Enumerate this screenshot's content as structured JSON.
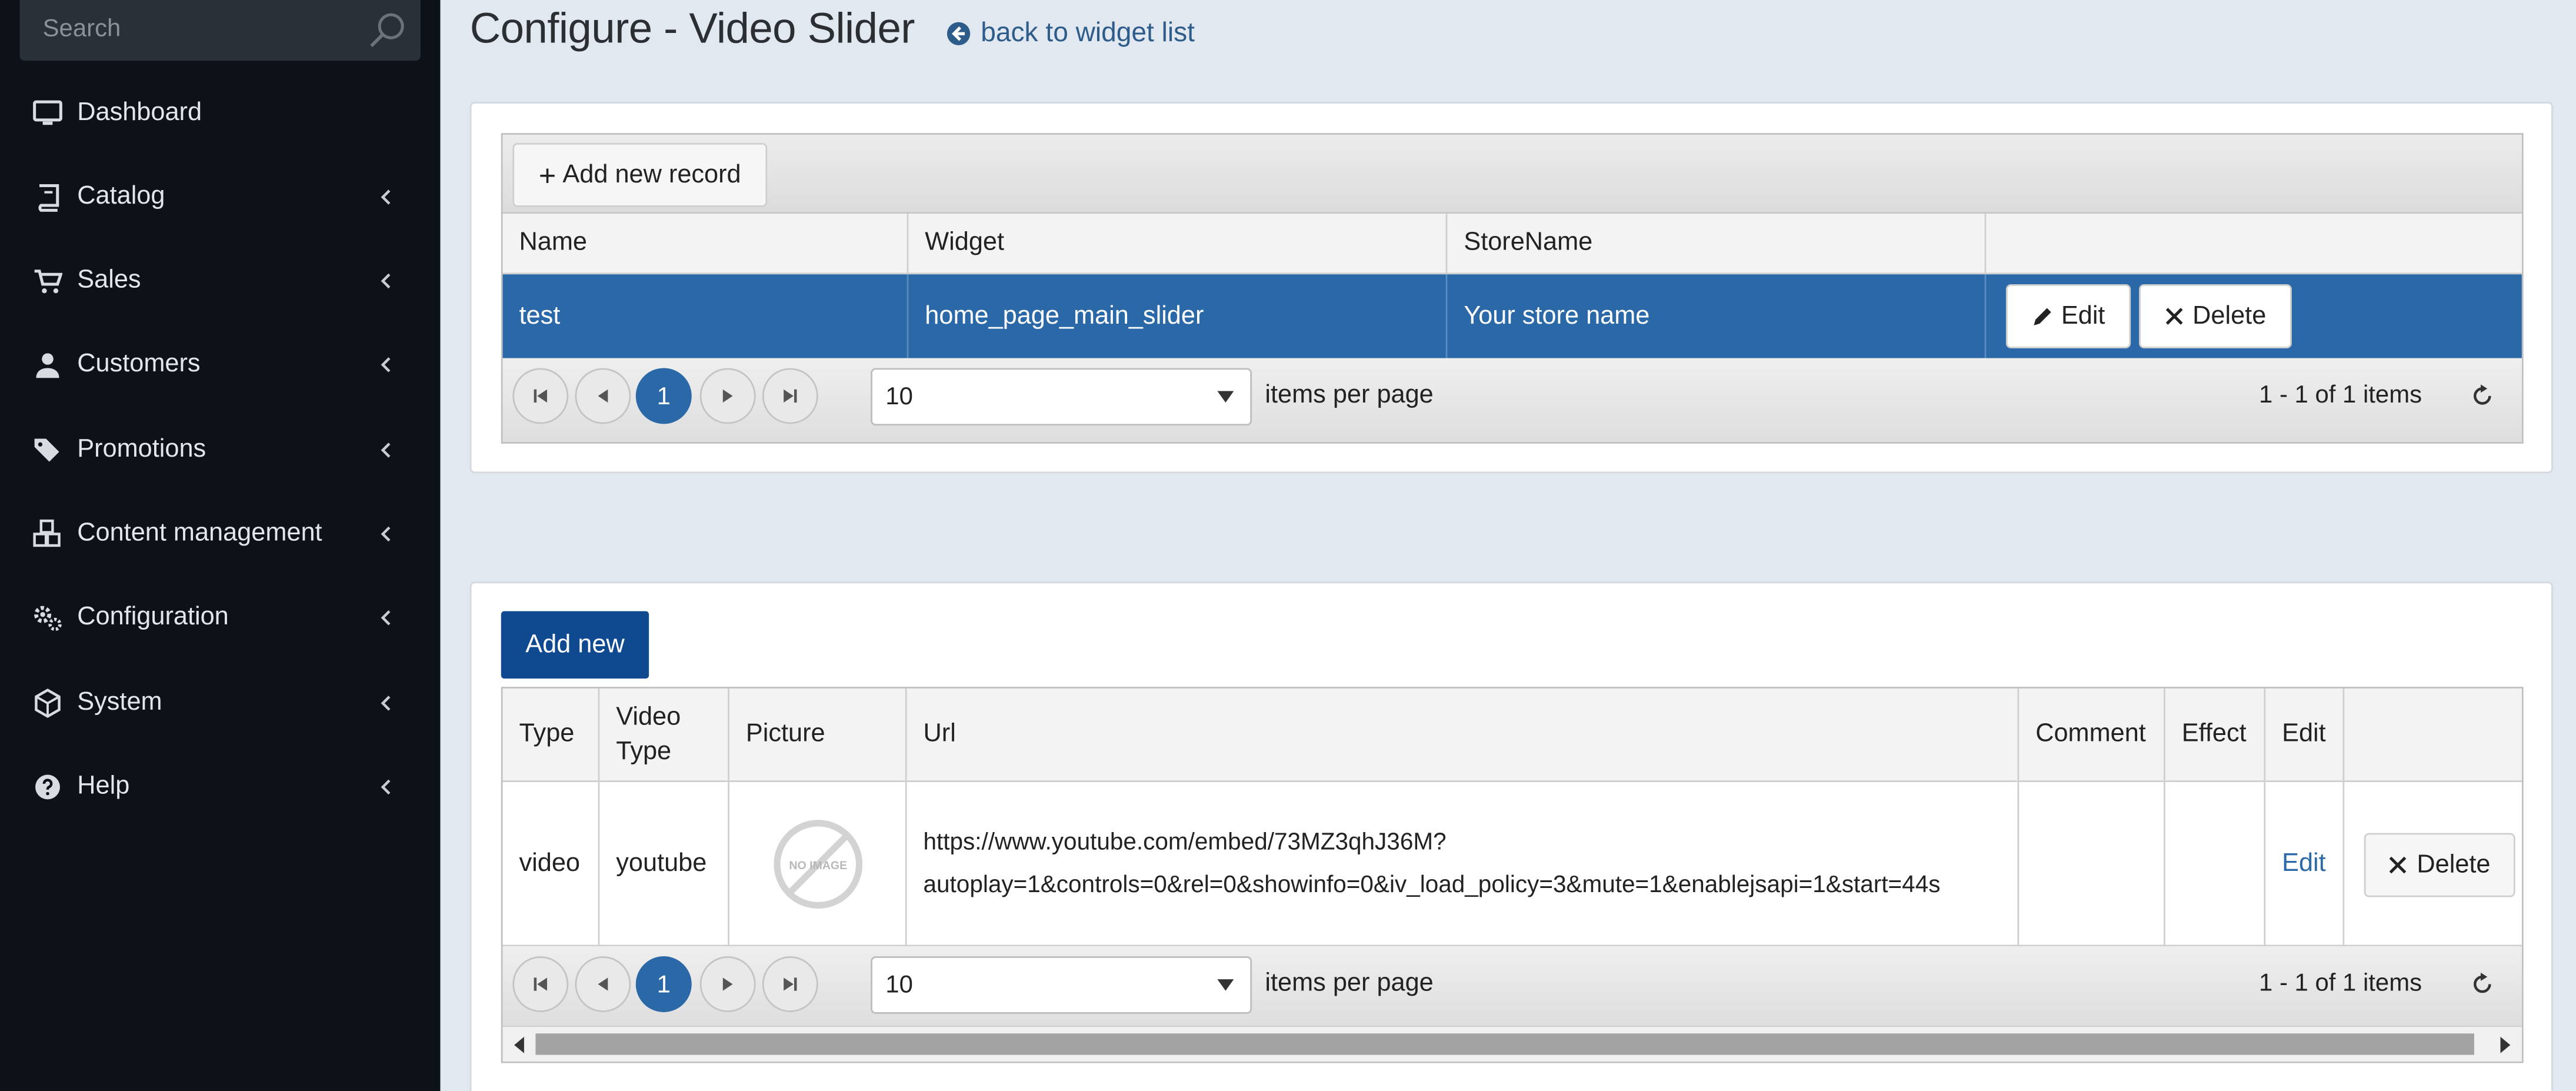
{
  "sidebar": {
    "search": {
      "placeholder": "Search"
    },
    "items": [
      {
        "label": "Dashboard",
        "icon": "desktop-icon",
        "has_submenu": false
      },
      {
        "label": "Catalog",
        "icon": "book-icon",
        "has_submenu": true
      },
      {
        "label": "Sales",
        "icon": "cart-icon",
        "has_submenu": true
      },
      {
        "label": "Customers",
        "icon": "user-icon",
        "has_submenu": true
      },
      {
        "label": "Promotions",
        "icon": "tags-icon",
        "has_submenu": true
      },
      {
        "label": "Content management",
        "icon": "cubes-icon",
        "has_submenu": true
      },
      {
        "label": "Configuration",
        "icon": "gears-icon",
        "has_submenu": true
      },
      {
        "label": "System",
        "icon": "cube-icon",
        "has_submenu": true
      },
      {
        "label": "Help",
        "icon": "question-circle-icon",
        "has_submenu": true
      }
    ]
  },
  "header": {
    "title": "Configure - Video Slider",
    "back_link": "back to widget list"
  },
  "records_grid": {
    "add_button": "Add new record",
    "columns": [
      "Name",
      "Widget",
      "StoreName"
    ],
    "rows": [
      {
        "name": "test",
        "widget": "home_page_main_slider",
        "store": "Your store name",
        "edit": "Edit",
        "delete": "Delete"
      }
    ],
    "pager": {
      "current_page": "1",
      "page_size": "10",
      "items_per_page": "items per page",
      "info": "1 - 1 of 1 items"
    }
  },
  "slides_grid": {
    "add_button": "Add new",
    "columns": {
      "type": "Type",
      "video_type_1": "Video",
      "video_type_2": "Type",
      "picture": "Picture",
      "url": "Url",
      "comment": "Comment",
      "effect": "Effect",
      "edit": "Edit"
    },
    "rows": [
      {
        "type": "video",
        "video_type": "youtube",
        "picture_text": "NO IMAGE",
        "url_line1": "https://www.youtube.com/embed/73MZ3qhJ36M?",
        "url_line2": "autoplay=1&controls=0&rel=0&showinfo=0&iv_load_policy=3&mute=1&enablejsapi=1&start=44s",
        "comment": "",
        "effect": "",
        "edit": "Edit",
        "delete": "Delete"
      }
    ],
    "pager": {
      "current_page": "1",
      "page_size": "10",
      "items_per_page": "items per page",
      "info": "1 - 1 of 1 items"
    }
  },
  "colors": {
    "sidebar_bg": "#0d1218",
    "selected_row": "#2a68a8",
    "primary_button": "#0f4a91",
    "link": "#2d5c8a",
    "page_bg": "#e2e8f0"
  }
}
